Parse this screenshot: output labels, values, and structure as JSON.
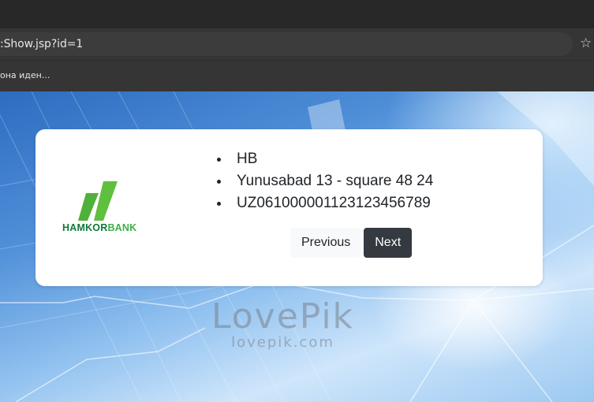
{
  "browser": {
    "url": ":Show.jsp?id=1",
    "bookmark": "она иден..."
  },
  "card": {
    "logo": {
      "part1": "HAMKOR",
      "part2": "BANK",
      "colors": {
        "dark_green": "#0f7a3a",
        "light_green": "#3fae49"
      }
    },
    "items": [
      "HB",
      "Yunusabad 13 - square 48 24",
      "UZ061000001123123456789"
    ],
    "buttons": {
      "previous": "Previous",
      "next": "Next"
    }
  },
  "watermark": {
    "title": "LovePik",
    "site": "lovepik.com"
  },
  "icons": {
    "bookmark_star": "star-icon"
  }
}
